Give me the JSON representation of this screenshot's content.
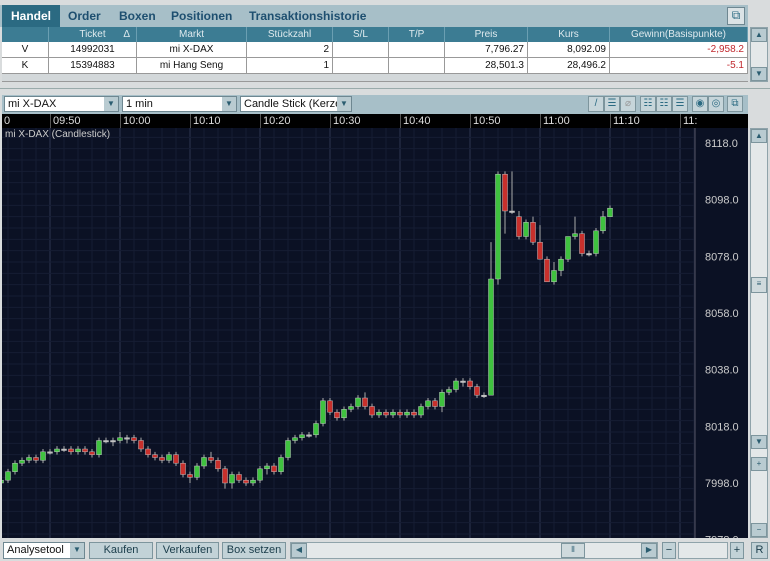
{
  "tabs": [
    "Handel",
    "Order",
    "Boxen",
    "Positionen",
    "Transaktionshistorie"
  ],
  "active_tab": "Handel",
  "table": {
    "columns": [
      "",
      "Ticket",
      "Markt",
      "Stückzahl",
      "S/L",
      "T/P",
      "Preis",
      "Kurs",
      "Gewinn(Basispunkte)"
    ],
    "sort_indicator": "Δ",
    "rows": [
      [
        "V",
        "14992031",
        "mi X-DAX",
        "2",
        "",
        "",
        "7,796.27",
        "8,092.09",
        "-2,958.2"
      ],
      [
        "K",
        "15394883",
        "mi Hang Seng",
        "1",
        "",
        "",
        "28,501.3",
        "28,496.2",
        "-5.1"
      ]
    ]
  },
  "chart_toolbar": {
    "instrument": "mi X-DAX",
    "interval": "1 min",
    "chart_type": "Candle Stick (Kerze"
  },
  "chart_data": {
    "type": "candlestick",
    "title": "mi X-DAX (Candlestick)",
    "x_ticks": [
      "0",
      "09:50",
      "10:00",
      "10:10",
      "10:20",
      "10:30",
      "10:40",
      "10:50",
      "11:00",
      "11:10",
      "11:"
    ],
    "y_ticks": [
      "8118.0",
      "8098.0",
      "8078.0",
      "8058.0",
      "8038.0",
      "8018.0",
      "7998.0",
      "7978.0"
    ],
    "ylim": [
      7976,
      8121
    ],
    "grid": true,
    "colors": {
      "up": "#3fc23f",
      "down": "#c8302c",
      "flat": "#bbbbbb",
      "background": "#0b1124"
    },
    "start_time": "09:43",
    "candles": [
      [
        7998,
        8000,
        7996,
        7999
      ],
      [
        7999,
        8003,
        7998,
        8002
      ],
      [
        8002,
        8006,
        8001,
        8005
      ],
      [
        8005,
        8007,
        8004,
        8006
      ],
      [
        8006,
        8008,
        8005,
        8007
      ],
      [
        8007,
        8008,
        8005,
        8006
      ],
      [
        8006,
        8010,
        8005,
        8009
      ],
      [
        8009,
        8010,
        8008,
        8009
      ],
      [
        8009,
        8011,
        8008,
        8010
      ],
      [
        8010,
        8011,
        8009,
        8010
      ],
      [
        8010,
        8011,
        8008,
        8009
      ],
      [
        8009,
        8011,
        8008,
        8010
      ],
      [
        8010,
        8011,
        8008,
        8009
      ],
      [
        8009,
        8010,
        8007,
        8008
      ],
      [
        8008,
        8014,
        8007,
        8013
      ],
      [
        8013,
        8014,
        8012,
        8013
      ],
      [
        8013,
        8014,
        8011,
        8013
      ],
      [
        8013,
        8016,
        8012,
        8014
      ],
      [
        8014,
        8015,
        8012,
        8014
      ],
      [
        8014,
        8015,
        8012,
        8013
      ],
      [
        8013,
        8014,
        8009,
        8010
      ],
      [
        8010,
        8011,
        8007,
        8008
      ],
      [
        8008,
        8009,
        8006,
        8007
      ],
      [
        8007,
        8008,
        8005,
        8006
      ],
      [
        8006,
        8009,
        8005,
        8008
      ],
      [
        8008,
        8009,
        8004,
        8005
      ],
      [
        8005,
        8006,
        8000,
        8001
      ],
      [
        8001,
        8002,
        7998,
        8000
      ],
      [
        8000,
        8005,
        7999,
        8004
      ],
      [
        8004,
        8008,
        8003,
        8007
      ],
      [
        8007,
        8009,
        8005,
        8006
      ],
      [
        8006,
        8007,
        8002,
        8003
      ],
      [
        8003,
        8004,
        7996,
        7998
      ],
      [
        7998,
        8002,
        7996,
        8001
      ],
      [
        8001,
        8002,
        7998,
        7999
      ],
      [
        7999,
        8000,
        7997,
        7998
      ],
      [
        7998,
        8000,
        7997,
        7999
      ],
      [
        7999,
        8004,
        7998,
        8003
      ],
      [
        8003,
        8005,
        8001,
        8004
      ],
      [
        8004,
        8005,
        8001,
        8002
      ],
      [
        8002,
        8008,
        8001,
        8007
      ],
      [
        8007,
        8014,
        8006,
        8013
      ],
      [
        8013,
        8015,
        8012,
        8014
      ],
      [
        8014,
        8016,
        8013,
        8015
      ],
      [
        8015,
        8016,
        8014,
        8015
      ],
      [
        8015,
        8020,
        8014,
        8019
      ],
      [
        8019,
        8028,
        8018,
        8027
      ],
      [
        8027,
        8028,
        8022,
        8023
      ],
      [
        8023,
        8024,
        8020,
        8021
      ],
      [
        8021,
        8025,
        8020,
        8024
      ],
      [
        8024,
        8026,
        8023,
        8025
      ],
      [
        8025,
        8029,
        8024,
        8028
      ],
      [
        8028,
        8030,
        8024,
        8025
      ],
      [
        8025,
        8026,
        8021,
        8022
      ],
      [
        8022,
        8024,
        8021,
        8023
      ],
      [
        8023,
        8024,
        8021,
        8022
      ],
      [
        8022,
        8024,
        8021,
        8023
      ],
      [
        8023,
        8024,
        8021,
        8022
      ],
      [
        8022,
        8024,
        8021,
        8023
      ],
      [
        8023,
        8024,
        8021,
        8022
      ],
      [
        8022,
        8026,
        8021,
        8025
      ],
      [
        8025,
        8028,
        8024,
        8027
      ],
      [
        8027,
        8028,
        8024,
        8025
      ],
      [
        8025,
        8031,
        8023,
        8030
      ],
      [
        8030,
        8032,
        8029,
        8031
      ],
      [
        8031,
        8035,
        8030,
        8034
      ],
      [
        8034,
        8035,
        8032,
        8034
      ],
      [
        8034,
        8035,
        8031,
        8032
      ],
      [
        8032,
        8033,
        8028,
        8029
      ],
      [
        8029,
        8030,
        8028,
        8029
      ],
      [
        8029,
        8083,
        8029,
        8070
      ],
      [
        8070,
        8108,
        8068,
        8107
      ],
      [
        8107,
        8108,
        8086,
        8094
      ],
      [
        8094,
        8108,
        8093,
        8094
      ],
      [
        8092,
        8094,
        8084,
        8085
      ],
      [
        8085,
        8091,
        8084,
        8090
      ],
      [
        8090,
        8092,
        8082,
        8083
      ],
      [
        8083,
        8089,
        8078,
        8077
      ],
      [
        8077,
        8078,
        8070,
        8069
      ],
      [
        8069,
        8076,
        8068,
        8073
      ],
      [
        8073,
        8078,
        8071,
        8077
      ],
      [
        8077,
        8085,
        8076,
        8085
      ],
      [
        8085,
        8092,
        8084,
        8086
      ],
      [
        8086,
        8087,
        8078,
        8079
      ],
      [
        8079,
        8080,
        8078,
        8079
      ],
      [
        8079,
        8088,
        8078,
        8087
      ],
      [
        8087,
        8094,
        8086,
        8092
      ],
      [
        8092,
        8096,
        8092,
        8095
      ]
    ]
  },
  "bottom": {
    "analysis_tool": "Analysetool",
    "buy": "Kaufen",
    "sell": "Verkaufen",
    "set_box": "Box setzen",
    "reset": "R",
    "minus": "−",
    "plus": "+"
  }
}
